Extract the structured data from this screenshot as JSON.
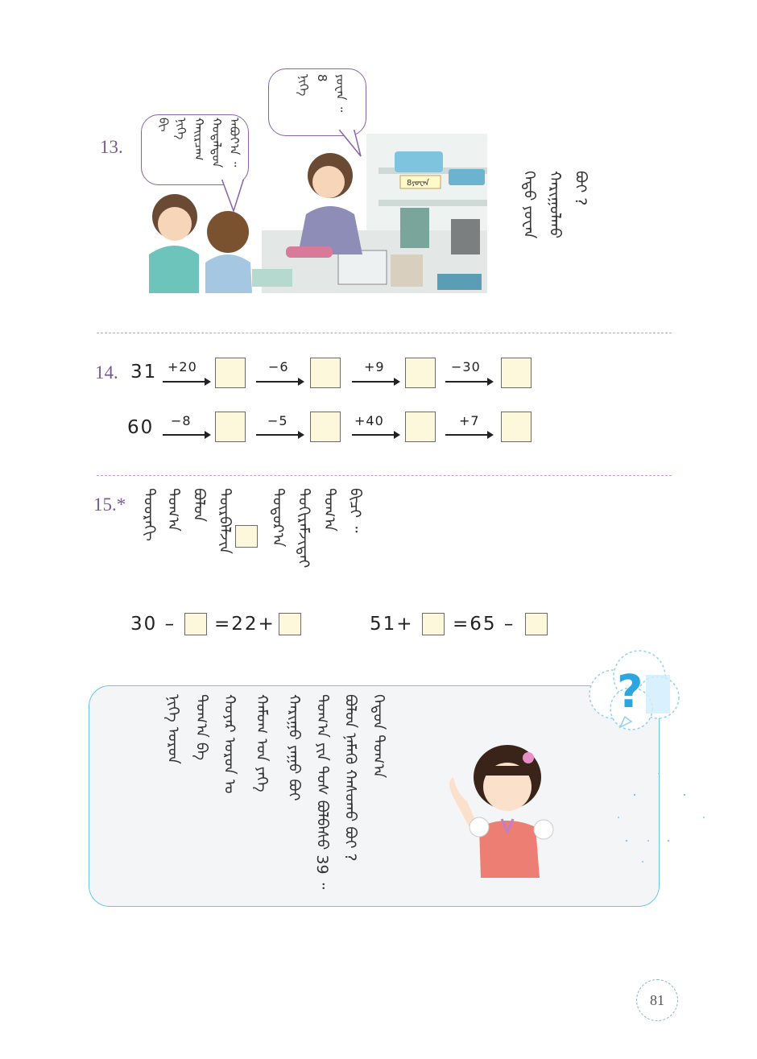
{
  "page": {
    "number": "81"
  },
  "problem13": {
    "number": "13.",
    "boy_speech": [
      "ᠪᠢ",
      "ᠨᠢᠭᠡ",
      "ᠬᠠᠢᠷᠴᠠᠭ",
      "ᠬᠤᠳᠠᠯᠳᠤᠨ",
      "ᠠᠪᠤᠶ᠎ᠠ ᠃"
    ],
    "seller_speech": [
      "ᠨᠢᠭᠡ",
      "8",
      "ᠶᠤᠸᠠᠨ ᠃"
    ],
    "price_tag": "8ᠶᠤᠸᠠᠨ",
    "question": [
      "ᠬᠡᠳᠦ ᠶᠤᠸᠠᠨ",
      "ᠬᠠᠷᠢᠭᠤᠯᠬᠤ",
      "ᠪᠤᠢ ?"
    ]
  },
  "problem14": {
    "number": "14.",
    "rows": [
      {
        "start": "31",
        "ops": [
          "+20",
          "−6",
          "+9",
          "−30"
        ]
      },
      {
        "start": "60",
        "ops": [
          "−8",
          "−5",
          "+40",
          "+7"
        ]
      }
    ]
  },
  "problem15": {
    "number": "15.*",
    "instruction": [
      "ᠳᠣᠣᠷᠠᠬᠢ",
      "ᠲᠣᠭ᠎ᠠ",
      "ᠪᠣᠯᠤᠨ",
      "ᠳᠥᠷᠪᠡᠯᠵᠢᠨ",
      "ᠳᠣᠲᠣᠷ᠎ᠠ",
      "ᠲᠣᠬᠢᠷᠠᠮᠵᠢᠲᠠᠢ",
      "ᠲᠣᠭ᠎ᠠ",
      "ᠪᠢᠴᠢ ᠃"
    ],
    "equations": [
      {
        "left": "30 –",
        "middle": "=22+"
      },
      {
        "left": "51+",
        "middle": "=65 –"
      }
    ]
  },
  "thinking_panel": {
    "icon": "question-cloud-icon",
    "columns": [
      "ᠬᠡᠳᠦᠨ ᠲᠣᠭ᠎ᠠ",
      "ᠪᠣᠯᠤᠨ ᠨᠡᠮᠡᠬᠦ ᠬᠠᠰᠤᠬᠤ ᠪᠣᠢ ?",
      "ᠲᠣᠭ᠎ᠠ ᠶᠢᠨ ᠲᠤᠰ ᠪᠣᠯᠪᠠᠰᠤ 39 ᠃",
      "ᠬᠠᠷᠢᠭᠤ ᠶᠠᠭᠤ ᠪᠣᠢ",
      "ᠬᠠᠮᠤᠭ ᠤᠨ ᠶᠡᠬᠡ",
      "ᠬᠣᠶᠠᠷ ᠣᠷᠣᠨ ᠤ",
      "ᠲᠣᠭ᠎ᠠ ᠪᠠ",
      "ᠨᠢᠭᠡ ᠣᠷᠣᠨ"
    ],
    "number_39": "39"
  },
  "colors": {
    "accent_purple": "#7a5a93",
    "box_fill": "#fdf8dc",
    "panel_border": "#67c7e8",
    "cloud": "#47b6e6"
  }
}
